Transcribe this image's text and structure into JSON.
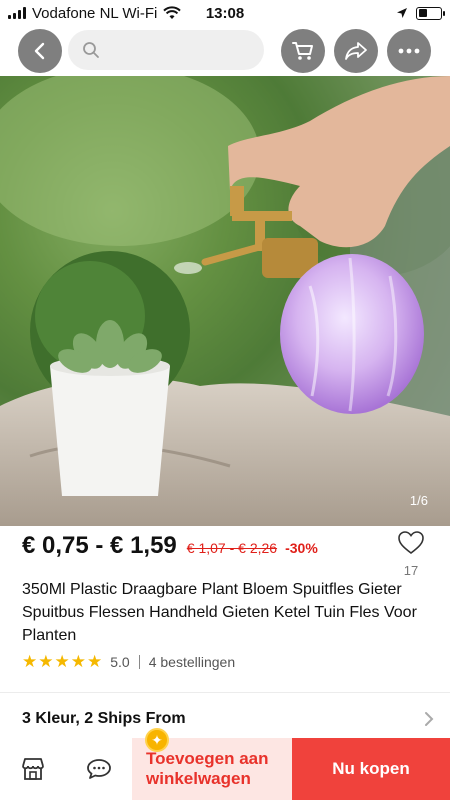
{
  "status_bar": {
    "carrier": "Vodafone NL Wi-Fi",
    "time": "13:08"
  },
  "image": {
    "counter": "1/6"
  },
  "product": {
    "price": "€ 0,75 - € 1,59",
    "old_price": "€ 1,07 - € 2,26",
    "discount": "-30%",
    "wishlist_count": "17",
    "title": "350Ml Plastic Draagbare Plant Bloem Spuitfles Gieter Spuitbus Flessen Handheld Gieten Ketel Tuin Fles Voor Planten",
    "rating": "5.0",
    "orders": "4 bestellingen",
    "variants": "3 Kleur, 2 Ships From"
  },
  "actions": {
    "add_to_cart": "Toevoegen aan winkelwagen",
    "buy_now": "Nu kopen"
  },
  "colors": {
    "accent_red": "#f0423c",
    "price_red": "#e0201a",
    "star_yellow": "#f5b800",
    "nav_button_gray": "#7f7f7f"
  },
  "icons": [
    "back-icon",
    "search-icon",
    "cart-icon",
    "share-icon",
    "more-icon",
    "heart-icon",
    "store-icon",
    "chat-icon",
    "chevron-right-icon",
    "coin-icon",
    "wifi-icon",
    "location-icon",
    "battery-icon"
  ]
}
